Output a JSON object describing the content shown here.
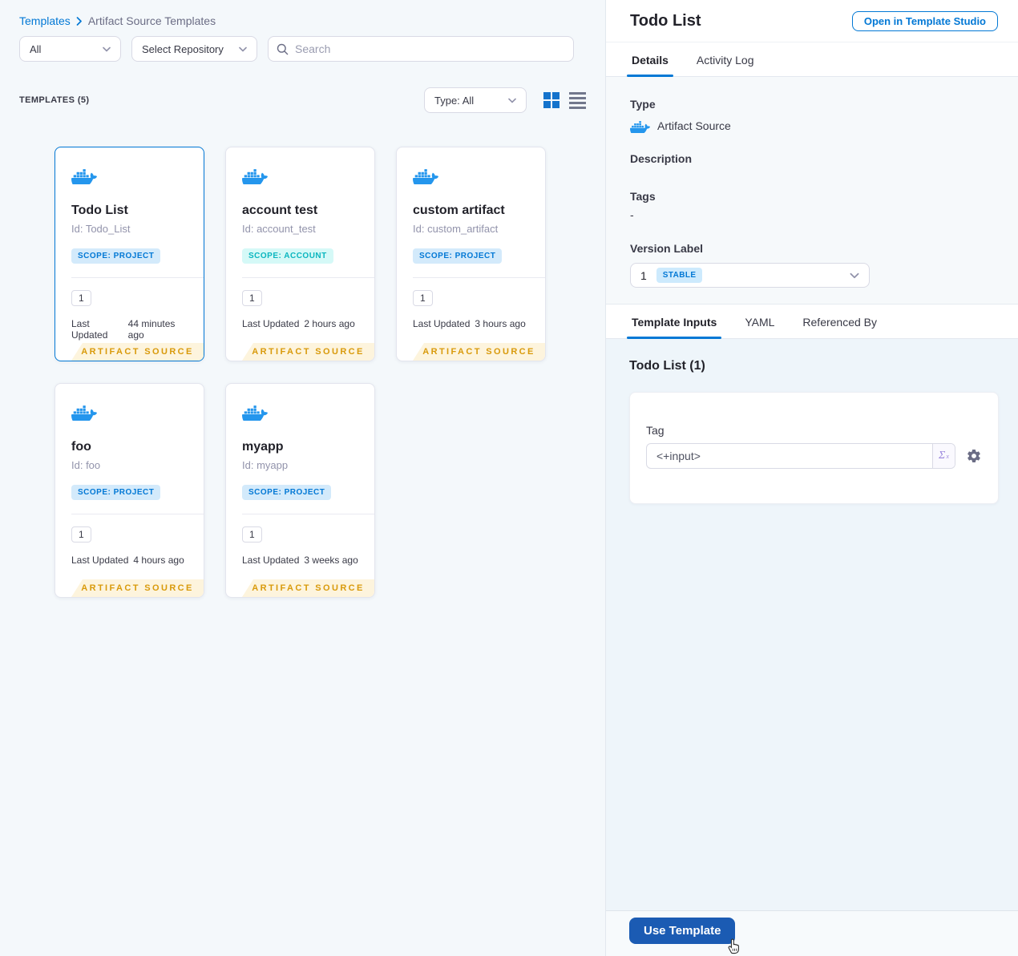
{
  "breadcrumb": {
    "root": "Templates",
    "current": "Artifact Source Templates"
  },
  "filters": {
    "scope_dropdown": "All",
    "repository_dropdown": "Select Repository",
    "search_placeholder": "Search"
  },
  "list_header": {
    "count_label": "TEMPLATES (5)",
    "type_dropdown": "Type: All"
  },
  "cards": [
    {
      "name": "Todo List",
      "id": "Id: Todo_List",
      "scope": "SCOPE: PROJECT",
      "scope_type": "project",
      "version": "1",
      "updated_label": "Last Updated",
      "updated_value": "44 minutes ago",
      "footer": "ARTIFACT SOURCE",
      "selected": true
    },
    {
      "name": "account test",
      "id": "Id: account_test",
      "scope": "SCOPE: ACCOUNT",
      "scope_type": "account",
      "version": "1",
      "updated_label": "Last Updated",
      "updated_value": "2 hours ago",
      "footer": "ARTIFACT SOURCE",
      "selected": false
    },
    {
      "name": "custom artifact",
      "id": "Id: custom_artifact",
      "scope": "SCOPE: PROJECT",
      "scope_type": "project",
      "version": "1",
      "updated_label": "Last Updated",
      "updated_value": "3 hours ago",
      "footer": "ARTIFACT SOURCE",
      "selected": false
    },
    {
      "name": "foo",
      "id": "Id: foo",
      "scope": "SCOPE: PROJECT",
      "scope_type": "project",
      "version": "1",
      "updated_label": "Last Updated",
      "updated_value": "4 hours ago",
      "footer": "ARTIFACT SOURCE",
      "selected": false
    },
    {
      "name": "myapp",
      "id": "Id: myapp",
      "scope": "SCOPE: PROJECT",
      "scope_type": "project",
      "version": "1",
      "updated_label": "Last Updated",
      "updated_value": "3 weeks ago",
      "footer": "ARTIFACT SOURCE",
      "selected": false
    }
  ],
  "details_panel": {
    "title": "Todo List",
    "open_studio_button": "Open in Template Studio",
    "tabs": [
      "Details",
      "Activity Log"
    ],
    "type_label": "Type",
    "type_value": "Artifact Source",
    "description_label": "Description",
    "tags_label": "Tags",
    "tags_value": "-",
    "version_label": "Version Label",
    "version_value": "1",
    "version_badge": "STABLE",
    "sub_tabs": [
      "Template Inputs",
      "YAML",
      "Referenced By"
    ],
    "inputs_heading": "Todo List (1)",
    "tag_field": {
      "label": "Tag",
      "value": "<+input>",
      "expression_symbol": "Σ",
      "expression_sup": "x"
    },
    "use_template_button": "Use Template"
  },
  "icons": [
    "docker-whale-icon",
    "search-icon",
    "chevron-down-icon",
    "chevron-right-icon",
    "grid-view-icon",
    "list-view-icon",
    "sigma-expression-icon",
    "gear-icon",
    "hand-cursor"
  ],
  "colors": {
    "accent_blue": "#0278d5",
    "docker_blue": "#2496ed",
    "use_template_button": "#1b5bb3",
    "scope_project_bg": "#d3eafb",
    "scope_project_text": "#0278d5",
    "scope_account_bg": "#d5f9f7",
    "scope_account_text": "#0bb6bf",
    "artifact_source_bg": "#fdf4dd",
    "artifact_source_text": "#d99a0b",
    "stable_badge_bg": "#cdeafd",
    "left_panel_bg": "#f4f8fb",
    "inputs_content_bg": "#eef5fa"
  }
}
